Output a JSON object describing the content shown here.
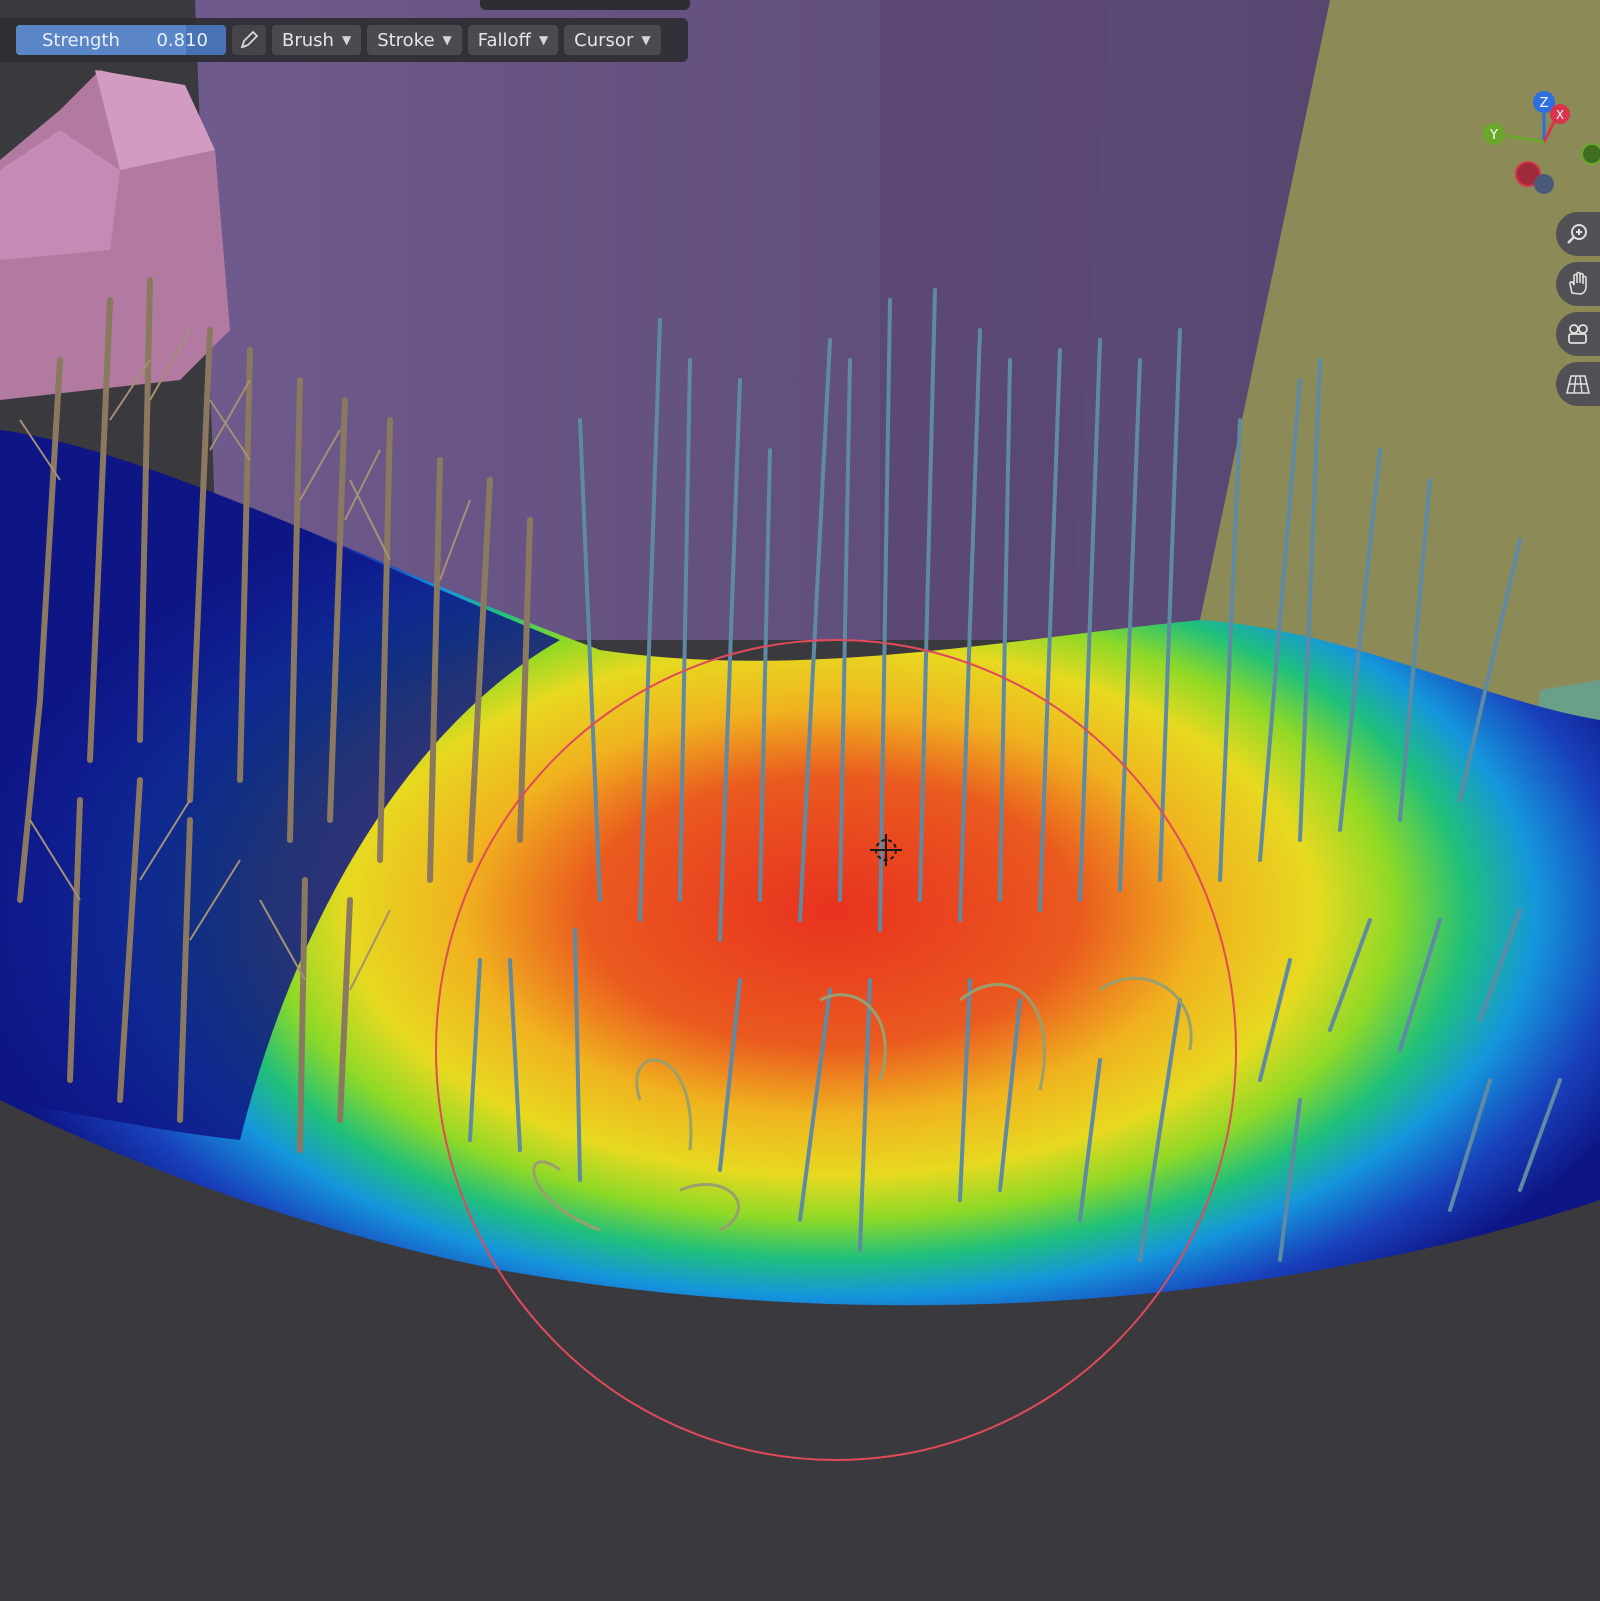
{
  "toolbar": {
    "strength_label": "Strength",
    "strength_value": "0.810",
    "strength_fraction": 0.81,
    "menus": [
      {
        "label": "Brush"
      },
      {
        "label": "Stroke"
      },
      {
        "label": "Falloff"
      },
      {
        "label": "Cursor"
      }
    ]
  },
  "gizmo": {
    "axes": [
      {
        "label": "Z",
        "color": "#2e6fdf"
      },
      {
        "label": "X",
        "color": "#d9344c"
      },
      {
        "label": "Y",
        "color": "#6aa82c"
      }
    ]
  },
  "nav_buttons": [
    {
      "icon": "zoom-icon"
    },
    {
      "icon": "hand-pan-icon"
    },
    {
      "icon": "camera-icon"
    },
    {
      "icon": "grid-icon"
    }
  ],
  "colors": {
    "header_bg": "#2e2e32",
    "active_slider": "#4772b3",
    "brush_circle": "#e04a5a",
    "ground_cold": "#0e1585",
    "ground_hot": "#e73a1d"
  }
}
